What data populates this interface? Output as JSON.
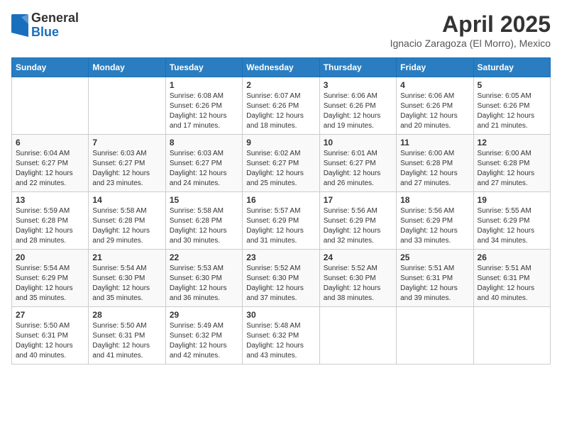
{
  "header": {
    "logo_general": "General",
    "logo_blue": "Blue",
    "month_title": "April 2025",
    "location": "Ignacio Zaragoza (El Morro), Mexico"
  },
  "weekdays": [
    "Sunday",
    "Monday",
    "Tuesday",
    "Wednesday",
    "Thursday",
    "Friday",
    "Saturday"
  ],
  "weeks": [
    [
      {
        "day": "",
        "sunrise": "",
        "sunset": "",
        "daylight": ""
      },
      {
        "day": "",
        "sunrise": "",
        "sunset": "",
        "daylight": ""
      },
      {
        "day": "1",
        "sunrise": "Sunrise: 6:08 AM",
        "sunset": "Sunset: 6:26 PM",
        "daylight": "Daylight: 12 hours and 17 minutes."
      },
      {
        "day": "2",
        "sunrise": "Sunrise: 6:07 AM",
        "sunset": "Sunset: 6:26 PM",
        "daylight": "Daylight: 12 hours and 18 minutes."
      },
      {
        "day": "3",
        "sunrise": "Sunrise: 6:06 AM",
        "sunset": "Sunset: 6:26 PM",
        "daylight": "Daylight: 12 hours and 19 minutes."
      },
      {
        "day": "4",
        "sunrise": "Sunrise: 6:06 AM",
        "sunset": "Sunset: 6:26 PM",
        "daylight": "Daylight: 12 hours and 20 minutes."
      },
      {
        "day": "5",
        "sunrise": "Sunrise: 6:05 AM",
        "sunset": "Sunset: 6:26 PM",
        "daylight": "Daylight: 12 hours and 21 minutes."
      }
    ],
    [
      {
        "day": "6",
        "sunrise": "Sunrise: 6:04 AM",
        "sunset": "Sunset: 6:27 PM",
        "daylight": "Daylight: 12 hours and 22 minutes."
      },
      {
        "day": "7",
        "sunrise": "Sunrise: 6:03 AM",
        "sunset": "Sunset: 6:27 PM",
        "daylight": "Daylight: 12 hours and 23 minutes."
      },
      {
        "day": "8",
        "sunrise": "Sunrise: 6:03 AM",
        "sunset": "Sunset: 6:27 PM",
        "daylight": "Daylight: 12 hours and 24 minutes."
      },
      {
        "day": "9",
        "sunrise": "Sunrise: 6:02 AM",
        "sunset": "Sunset: 6:27 PM",
        "daylight": "Daylight: 12 hours and 25 minutes."
      },
      {
        "day": "10",
        "sunrise": "Sunrise: 6:01 AM",
        "sunset": "Sunset: 6:27 PM",
        "daylight": "Daylight: 12 hours and 26 minutes."
      },
      {
        "day": "11",
        "sunrise": "Sunrise: 6:00 AM",
        "sunset": "Sunset: 6:28 PM",
        "daylight": "Daylight: 12 hours and 27 minutes."
      },
      {
        "day": "12",
        "sunrise": "Sunrise: 6:00 AM",
        "sunset": "Sunset: 6:28 PM",
        "daylight": "Daylight: 12 hours and 27 minutes."
      }
    ],
    [
      {
        "day": "13",
        "sunrise": "Sunrise: 5:59 AM",
        "sunset": "Sunset: 6:28 PM",
        "daylight": "Daylight: 12 hours and 28 minutes."
      },
      {
        "day": "14",
        "sunrise": "Sunrise: 5:58 AM",
        "sunset": "Sunset: 6:28 PM",
        "daylight": "Daylight: 12 hours and 29 minutes."
      },
      {
        "day": "15",
        "sunrise": "Sunrise: 5:58 AM",
        "sunset": "Sunset: 6:28 PM",
        "daylight": "Daylight: 12 hours and 30 minutes."
      },
      {
        "day": "16",
        "sunrise": "Sunrise: 5:57 AM",
        "sunset": "Sunset: 6:29 PM",
        "daylight": "Daylight: 12 hours and 31 minutes."
      },
      {
        "day": "17",
        "sunrise": "Sunrise: 5:56 AM",
        "sunset": "Sunset: 6:29 PM",
        "daylight": "Daylight: 12 hours and 32 minutes."
      },
      {
        "day": "18",
        "sunrise": "Sunrise: 5:56 AM",
        "sunset": "Sunset: 6:29 PM",
        "daylight": "Daylight: 12 hours and 33 minutes."
      },
      {
        "day": "19",
        "sunrise": "Sunrise: 5:55 AM",
        "sunset": "Sunset: 6:29 PM",
        "daylight": "Daylight: 12 hours and 34 minutes."
      }
    ],
    [
      {
        "day": "20",
        "sunrise": "Sunrise: 5:54 AM",
        "sunset": "Sunset: 6:29 PM",
        "daylight": "Daylight: 12 hours and 35 minutes."
      },
      {
        "day": "21",
        "sunrise": "Sunrise: 5:54 AM",
        "sunset": "Sunset: 6:30 PM",
        "daylight": "Daylight: 12 hours and 35 minutes."
      },
      {
        "day": "22",
        "sunrise": "Sunrise: 5:53 AM",
        "sunset": "Sunset: 6:30 PM",
        "daylight": "Daylight: 12 hours and 36 minutes."
      },
      {
        "day": "23",
        "sunrise": "Sunrise: 5:52 AM",
        "sunset": "Sunset: 6:30 PM",
        "daylight": "Daylight: 12 hours and 37 minutes."
      },
      {
        "day": "24",
        "sunrise": "Sunrise: 5:52 AM",
        "sunset": "Sunset: 6:30 PM",
        "daylight": "Daylight: 12 hours and 38 minutes."
      },
      {
        "day": "25",
        "sunrise": "Sunrise: 5:51 AM",
        "sunset": "Sunset: 6:31 PM",
        "daylight": "Daylight: 12 hours and 39 minutes."
      },
      {
        "day": "26",
        "sunrise": "Sunrise: 5:51 AM",
        "sunset": "Sunset: 6:31 PM",
        "daylight": "Daylight: 12 hours and 40 minutes."
      }
    ],
    [
      {
        "day": "27",
        "sunrise": "Sunrise: 5:50 AM",
        "sunset": "Sunset: 6:31 PM",
        "daylight": "Daylight: 12 hours and 40 minutes."
      },
      {
        "day": "28",
        "sunrise": "Sunrise: 5:50 AM",
        "sunset": "Sunset: 6:31 PM",
        "daylight": "Daylight: 12 hours and 41 minutes."
      },
      {
        "day": "29",
        "sunrise": "Sunrise: 5:49 AM",
        "sunset": "Sunset: 6:32 PM",
        "daylight": "Daylight: 12 hours and 42 minutes."
      },
      {
        "day": "30",
        "sunrise": "Sunrise: 5:48 AM",
        "sunset": "Sunset: 6:32 PM",
        "daylight": "Daylight: 12 hours and 43 minutes."
      },
      {
        "day": "",
        "sunrise": "",
        "sunset": "",
        "daylight": ""
      },
      {
        "day": "",
        "sunrise": "",
        "sunset": "",
        "daylight": ""
      },
      {
        "day": "",
        "sunrise": "",
        "sunset": "",
        "daylight": ""
      }
    ]
  ]
}
